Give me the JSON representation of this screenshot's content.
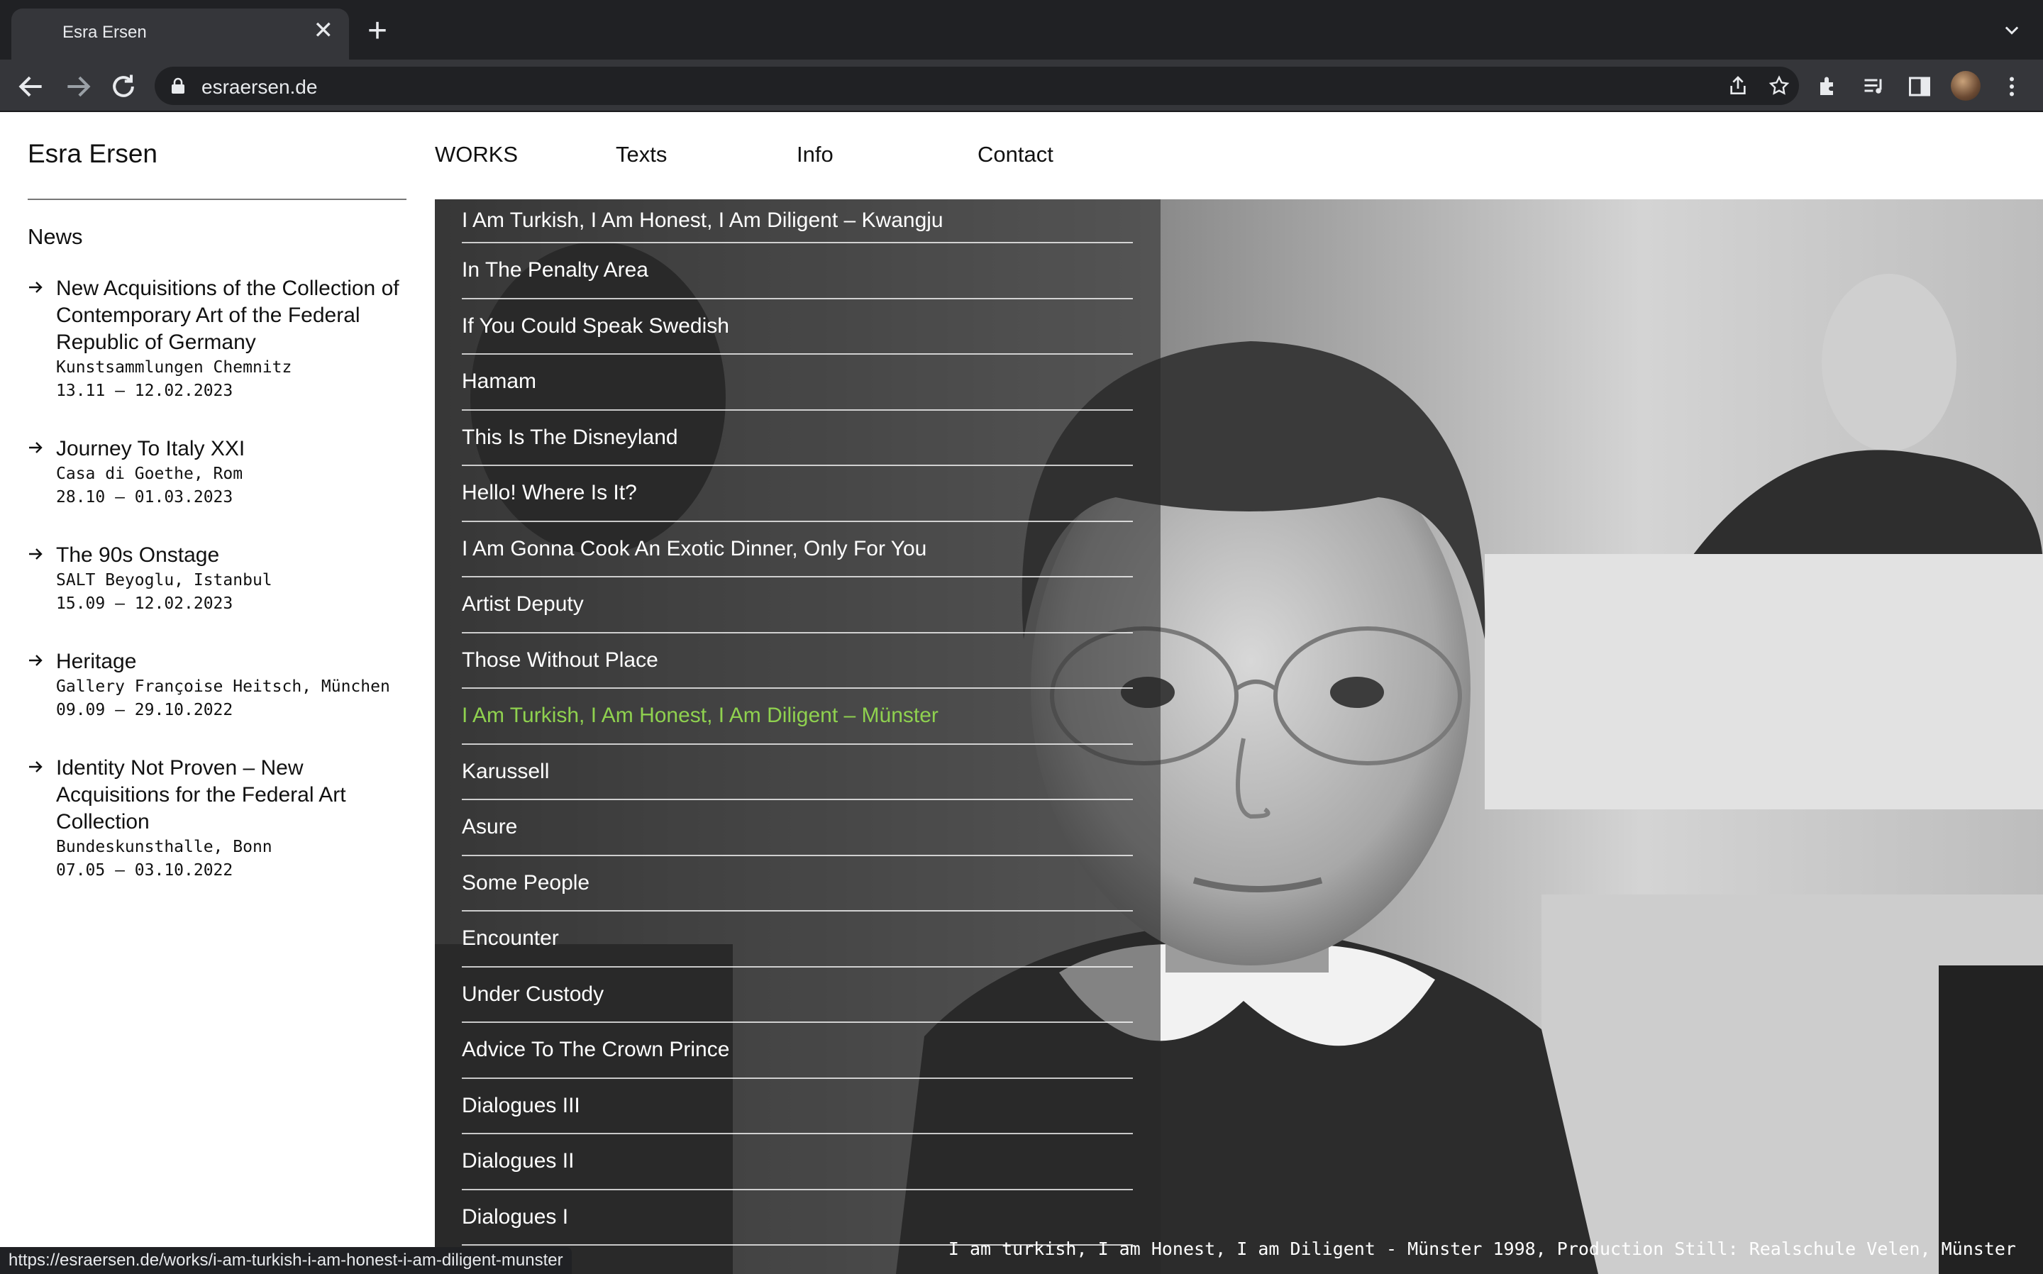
{
  "browser": {
    "tab_title": "Esra Ersen",
    "url": "esraersen.de",
    "status_url": "https://esraersen.de/works/i-am-turkish-i-am-honest-i-am-diligent-munster"
  },
  "site": {
    "title": "Esra Ersen",
    "nav": [
      "WORKS",
      "Texts",
      "Info",
      "Contact"
    ]
  },
  "news": {
    "heading": "News",
    "items": [
      {
        "title": "New Acquisitions of the Collection of Contemporary Art of the Federal Republic of Germany",
        "venue": "Kunstsammlungen Chemnitz",
        "dates": "13.11 – 12.02.2023"
      },
      {
        "title": "Journey To Italy XXI",
        "venue": "Casa di Goethe, Rom",
        "dates": "28.10 – 01.03.2023"
      },
      {
        "title": "The 90s Onstage",
        "venue": "SALT Beyoglu, Istanbul",
        "dates": "15.09 – 12.02.2023"
      },
      {
        "title": "Heritage",
        "venue": "Gallery Françoise Heitsch, München",
        "dates": "09.09 – 29.10.2022"
      },
      {
        "title": "Identity Not Proven – New Acquisitions for the Federal Art Collection",
        "venue": "Bundeskunsthalle, Bonn",
        "dates": "07.05 – 03.10.2022"
      }
    ]
  },
  "works": {
    "active_index": 9,
    "active_color": "#8fd14f",
    "items": [
      "I Am Turkish, I Am Honest, I Am Diligent – Kwangju",
      "In The Penalty Area",
      "If You Could Speak Swedish",
      "Hamam",
      "This Is The Disneyland",
      "Hello! Where Is It?",
      "I Am Gonna Cook An Exotic Dinner, Only For You",
      "Artist Deputy",
      "Those Without Place",
      "I Am Turkish, I Am Honest, I Am Diligent – Münster",
      "Karussell",
      "Asure",
      "Some People",
      "Encounter",
      "Under Custody",
      "Advice To The Crown Prince",
      "Dialogues III",
      "Dialogues II",
      "Dialogues I"
    ]
  },
  "caption": "I am turkish, I am Honest, I am Diligent - Münster 1998, Production Still: Realschule Velen, Münster"
}
